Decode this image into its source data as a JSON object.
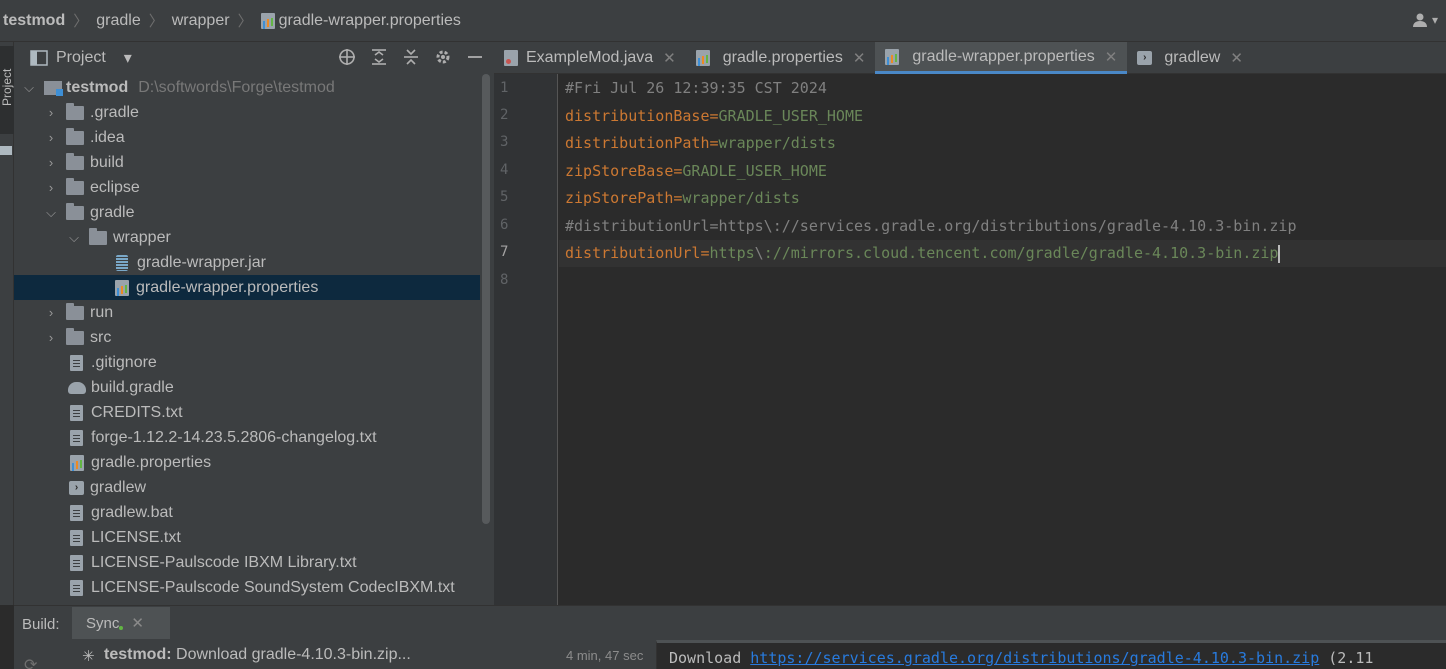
{
  "navbar": {
    "crumbs": [
      "testmod",
      "gradle",
      "wrapper",
      "gradle-wrapper.properties"
    ],
    "user_icon": "user-icon"
  },
  "stripe": {
    "project_label": "Project"
  },
  "project_panel": {
    "title": "Project",
    "tools": [
      "locate-icon",
      "expand-all-icon",
      "collapse-all-icon",
      "gear-icon",
      "minimize-icon"
    ],
    "root": {
      "name": "testmod",
      "path": "D:\\softwords\\Forge\\testmod"
    },
    "items": [
      ".gradle",
      ".idea",
      "build",
      "eclipse",
      "gradle",
      "wrapper",
      "gradle-wrapper.jar",
      "gradle-wrapper.properties",
      "run",
      "src",
      ".gitignore",
      "build.gradle",
      "CREDITS.txt",
      "forge-1.12.2-14.23.5.2806-changelog.txt",
      "gradle.properties",
      "gradlew",
      "gradlew.bat",
      "LICENSE.txt",
      "LICENSE-Paulscode IBXM Library.txt",
      "LICENSE-Paulscode SoundSystem CodecIBXM.txt"
    ]
  },
  "tabs": [
    "ExampleMod.java",
    "gradle.properties",
    "gradle-wrapper.properties",
    "gradlew"
  ],
  "editor": {
    "line_numbers": [
      "1",
      "2",
      "3",
      "4",
      "5",
      "6",
      "7",
      "8"
    ],
    "lines": [
      {
        "comment": "#Fri Jul 26 12:39:35 CST 2024"
      },
      {
        "key": "distributionBase",
        "eq": "=",
        "value": "GRADLE_USER_HOME"
      },
      {
        "key": "distributionPath",
        "eq": "=",
        "value": "wrapper/dists"
      },
      {
        "key": "zipStoreBase",
        "eq": "=",
        "value": "GRADLE_USER_HOME"
      },
      {
        "key": "zipStorePath",
        "eq": "=",
        "value": "wrapper/dists"
      },
      {
        "comment": "#distributionUrl=https\\://services.gradle.org/distributions/gradle-4.10.3-bin.zip"
      },
      {
        "key": "distributionUrl",
        "eq": "=",
        "value1": "https",
        "esc": "\\",
        "value2": "://mirrors.cloud.tencent.com/gradle/gradle-4.10.3-bin.zip"
      }
    ]
  },
  "build": {
    "label": "Build:",
    "tab": "Sync",
    "task_name": "testmod:",
    "task_text": " Download gradle-4.10.3-bin.zip...",
    "time": "4 min, 47 sec",
    "console_prefix": "Download ",
    "console_link": "https://services.gradle.org/distributions/gradle-4.10.3-bin.zip",
    "console_suffix": " (2.11"
  }
}
